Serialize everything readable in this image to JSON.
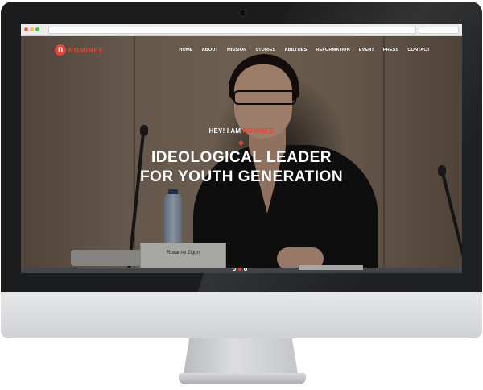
{
  "site": {
    "logo_letter": "n",
    "logo_text": "NOMINEE",
    "accent_color": "#e5443b"
  },
  "nav": {
    "items": [
      "HOME",
      "ABOUT",
      "MISSION",
      "STORIES",
      "ABILITIES",
      "REFORMATION",
      "EVENT",
      "PRESS",
      "CONTACT"
    ]
  },
  "hero": {
    "eyebrow_prefix": "HEY! I AM ",
    "eyebrow_accent": "NOMINEE",
    "headline_line1": "IDEOLOGICAL LEADER",
    "headline_line2": "FOR YOUTH GENERATION",
    "nameplate": "Roxanne Zigon"
  },
  "slider": {
    "total_slides": 3,
    "active_slide": 2
  },
  "icons": {
    "logo": "n-circle-logo",
    "pager": "slider-dot-icon"
  }
}
